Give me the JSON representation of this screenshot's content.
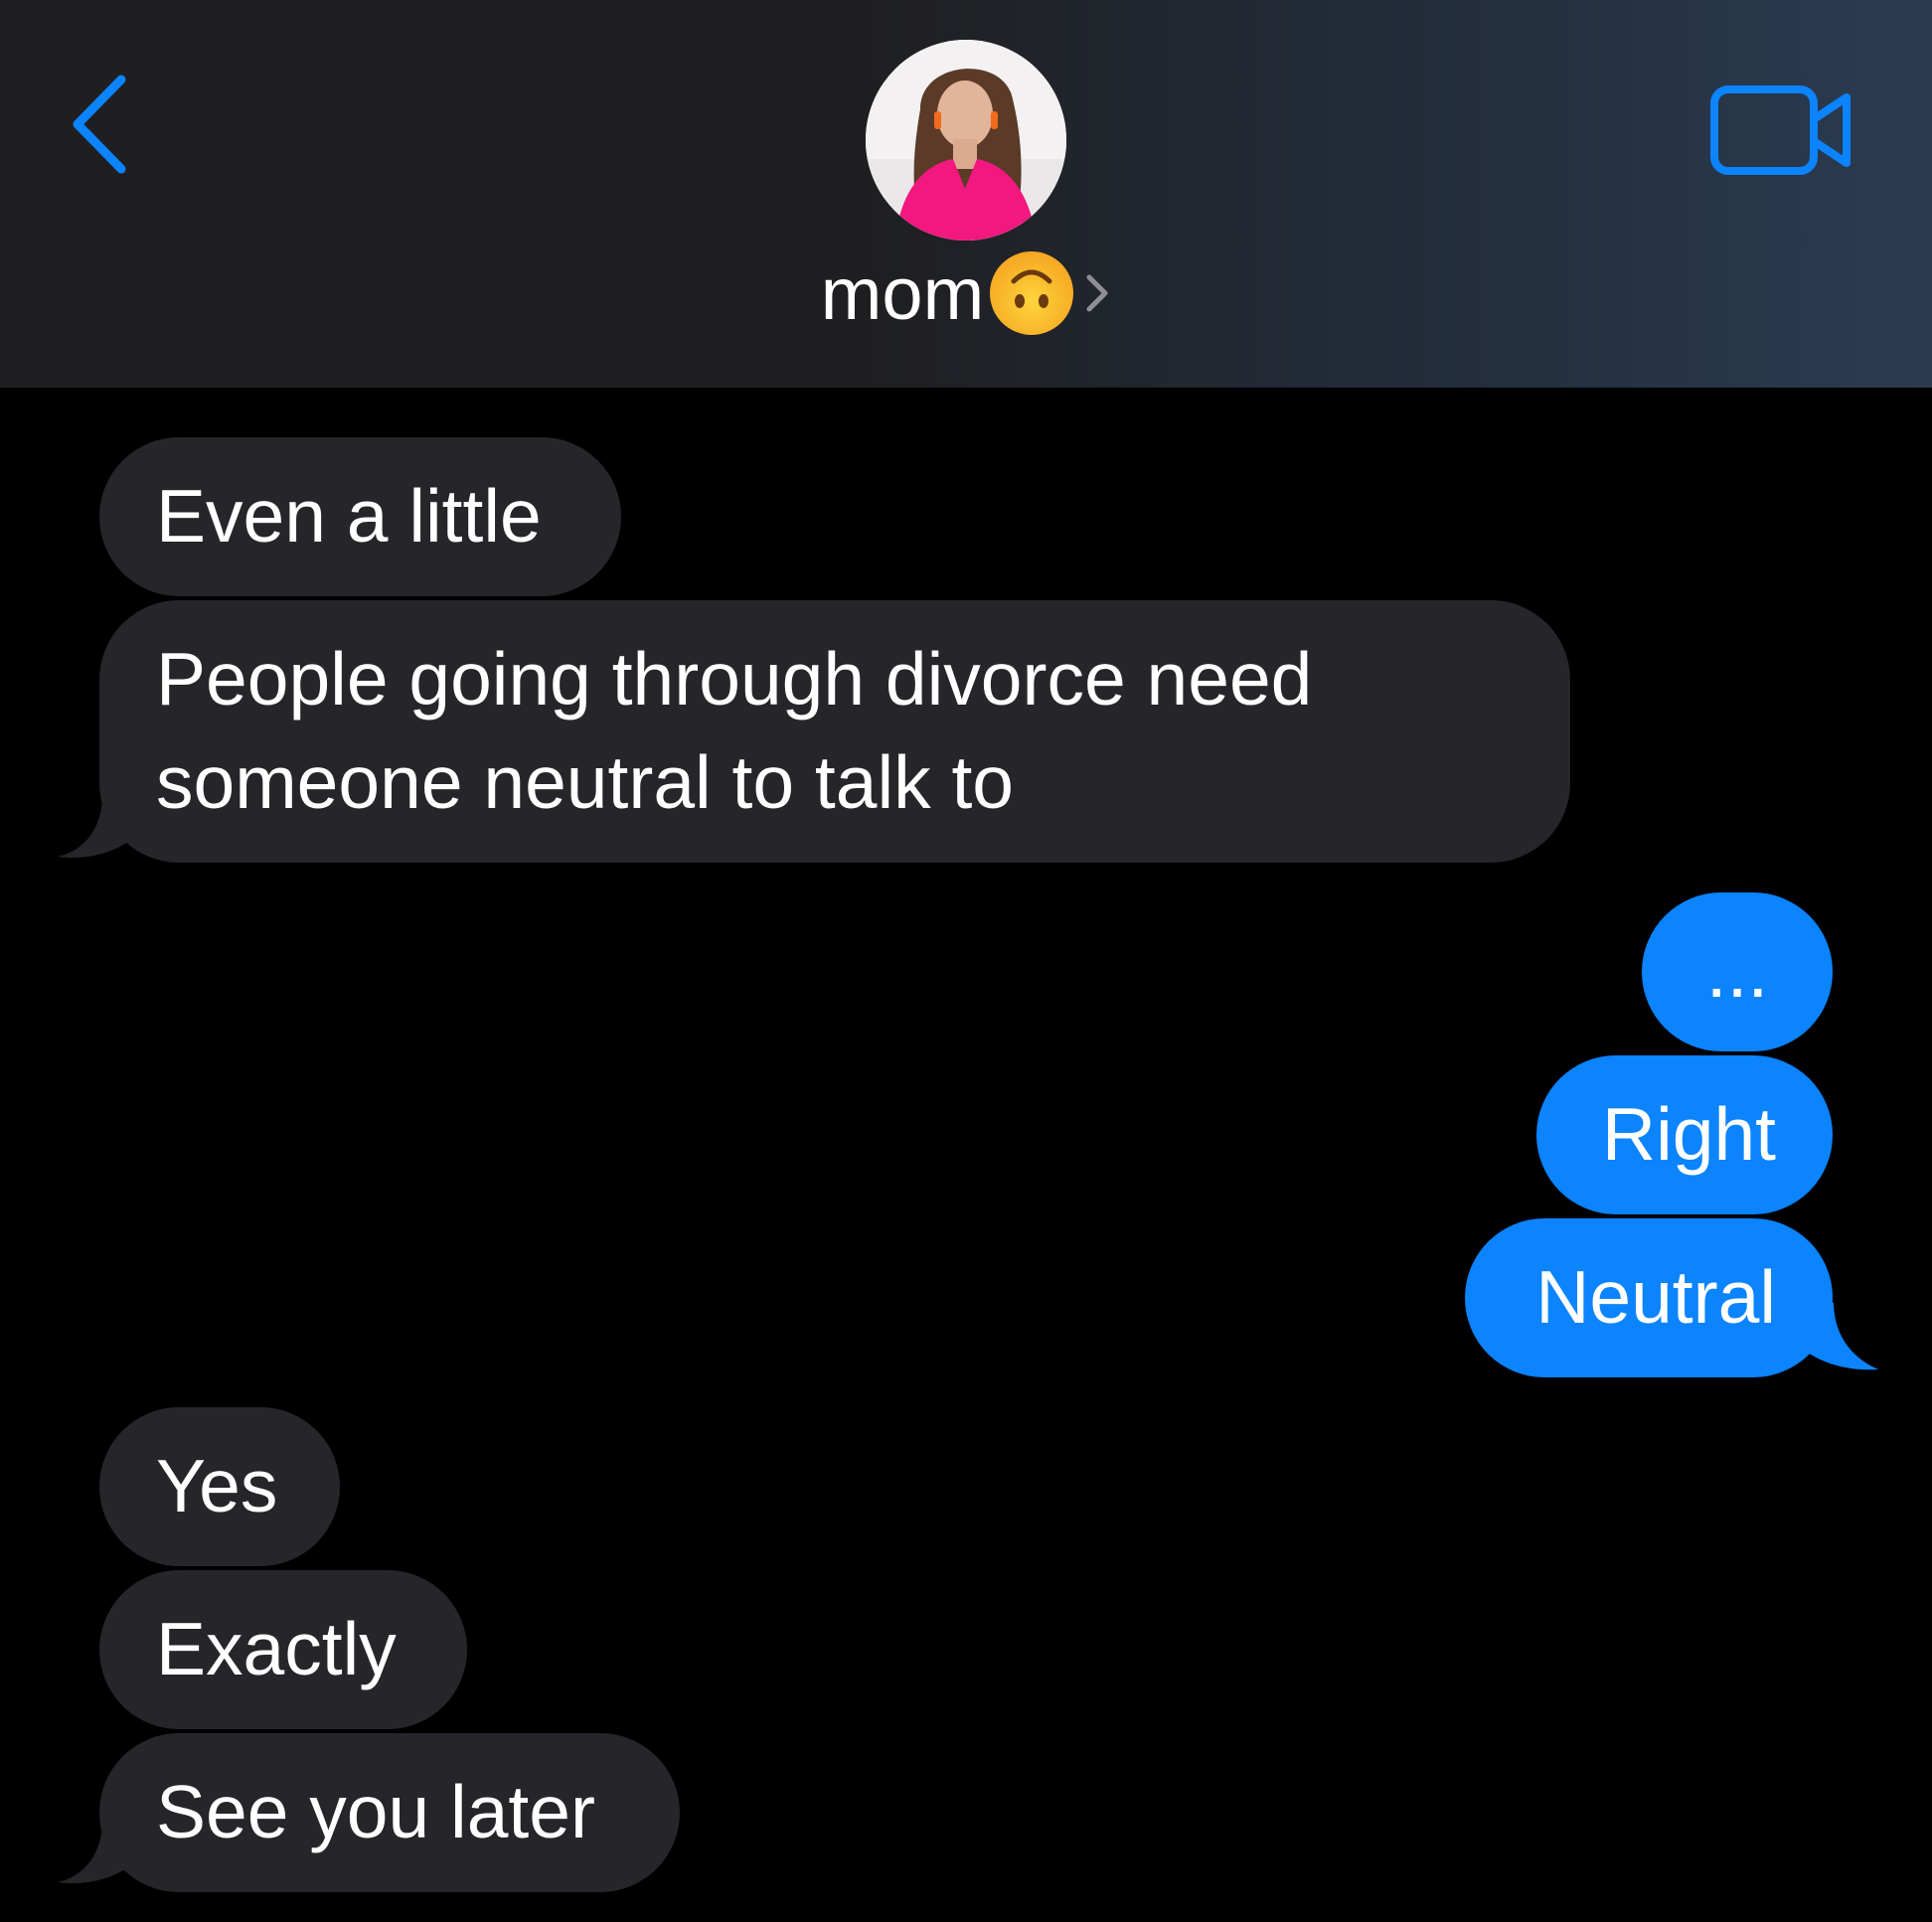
{
  "header": {
    "contact_name": "mom",
    "contact_emoji": "upside-down-face-emoji",
    "back_icon": "chevron-left-icon",
    "video_icon": "video-camera-icon",
    "accent_color": "#0b84fe"
  },
  "messages": [
    {
      "direction": "incoming",
      "text": "Even a little"
    },
    {
      "direction": "incoming",
      "text": "People going through divorce need someone neutral to talk to"
    },
    {
      "direction": "outgoing",
      "text": "..."
    },
    {
      "direction": "outgoing",
      "text": "Right"
    },
    {
      "direction": "outgoing",
      "text": "Neutral"
    },
    {
      "direction": "incoming",
      "text": "Yes"
    },
    {
      "direction": "incoming",
      "text": "Exactly"
    },
    {
      "direction": "incoming",
      "text": "See you later"
    }
  ],
  "colors": {
    "incoming_bubble": "#26252a",
    "outgoing_bubble": "#0b84fe",
    "background": "#000000"
  }
}
